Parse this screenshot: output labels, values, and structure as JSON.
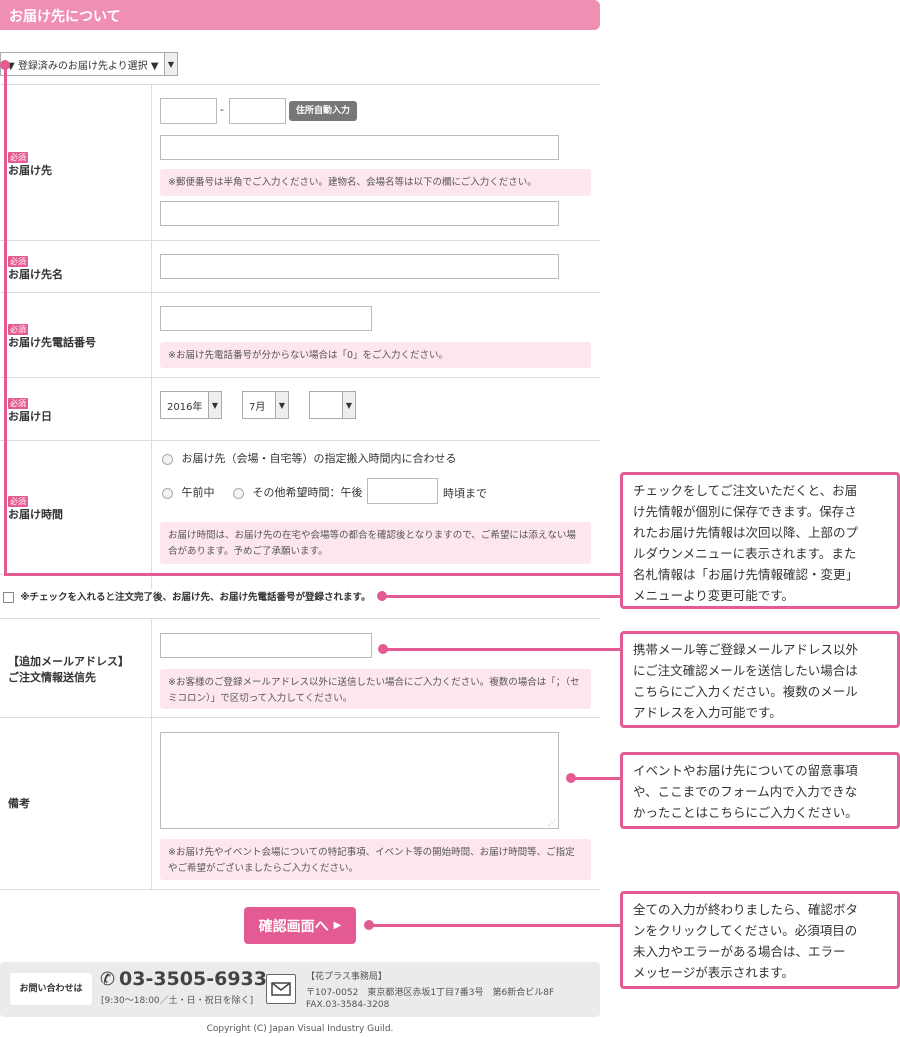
{
  "section_title": "お届け先について",
  "address_select": "▼ 登録済みのお届け先より選択 ▼",
  "required_badge": "必須",
  "fields": {
    "address": {
      "label": "お届け先",
      "zip_separator": "-",
      "auto_button": "住所自動入力",
      "note": "※郵便番号は半角でご入力ください。建物名、会場名等は以下の欄にご入力ください。"
    },
    "name": {
      "label": "お届け先名"
    },
    "phone": {
      "label": "お届け先電話番号",
      "note": "※お届け先電話番号が分からない場合は「0」をご入力ください。"
    },
    "date": {
      "label": "お届け日",
      "year": "2016年",
      "month": "7月",
      "day": ""
    },
    "time": {
      "label": "お届け時間",
      "option1": "お届け先（会場・自宅等）の指定搬入時間内に合わせる",
      "option2": "午前中",
      "option3": "その他希望時間：午後",
      "option3_suffix": "時頃まで",
      "note": "お届け時間は、お届け先の在宅や会場等の都合を確認後となりますので、ご希望には添えない場合があります。予めご了承願います。"
    }
  },
  "register_checkbox": "※チェックを入れると注文完了後、お届け先、お届け先電話番号が登録されます。",
  "extra_email": {
    "label1": "【追加メールアドレス】",
    "label2": "ご注文情報送信先",
    "note": "※お客様のご登録メールアドレス以外に送信したい場合にご入力ください。複数の場合は「；（セミコロン）」で区切って入力してください。"
  },
  "remarks": {
    "label": "備考",
    "note": "※お届け先やイベント会場についての特記事項、イベント等の開始時間、お届け時間等、ご指定やご希望がございましたらご入力ください。"
  },
  "confirm_button": "確認画面へ",
  "callouts": {
    "c1": [
      "チェックをしてご注文いただくと、お届",
      "け先情報が個別に保存できます。保存さ",
      "れたお届け先情報は次回以降、上部のプ",
      "ルダウンメニューに表示されます。また",
      "名札情報は「お届け先情報確認・変更」",
      "メニューより変更可能です。"
    ],
    "c2": [
      "携帯メール等ご登録メールアドレス以外",
      "にご注文確認メールを送信したい場合は",
      "こちらにご入力ください。複数のメール",
      "アドレスを入力可能です。"
    ],
    "c3": [
      "イベントやお届け先についての留意事項",
      "や、ここまでのフォーム内で入力できな",
      "かったことはこちらにご入力ください。"
    ],
    "c4": [
      "全ての入力が終わりましたら、確認ボタ",
      "ンをクリックしてください。必須項目の",
      "未入力やエラーがある場合は、エラー",
      "メッセージが表示されます。"
    ]
  },
  "footer": {
    "contact_label": "お問い合わせは",
    "phone": "03-3505-6933",
    "hours": "[9:30〜18:00／土・日・祝日を除く]",
    "office": "【花プラス事務局】",
    "address": "〒107-0052　東京都港区赤坂1丁目7番3号　第6新合ビル8F",
    "fax": "FAX.03-3584-3208",
    "copyright": "Copyright (C) Japan Visual Industry Guild."
  }
}
